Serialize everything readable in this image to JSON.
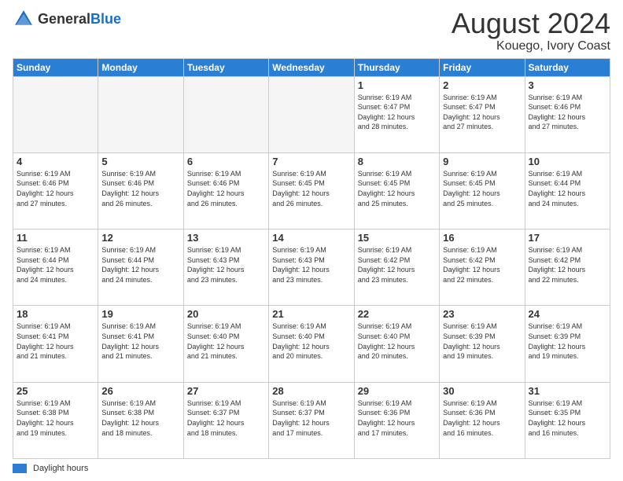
{
  "header": {
    "logo_general": "General",
    "logo_blue": "Blue",
    "month_year": "August 2024",
    "location": "Kouego, Ivory Coast"
  },
  "weekdays": [
    "Sunday",
    "Monday",
    "Tuesday",
    "Wednesday",
    "Thursday",
    "Friday",
    "Saturday"
  ],
  "weeks": [
    [
      {
        "day": "",
        "info": ""
      },
      {
        "day": "",
        "info": ""
      },
      {
        "day": "",
        "info": ""
      },
      {
        "day": "",
        "info": ""
      },
      {
        "day": "1",
        "info": "Sunrise: 6:19 AM\nSunset: 6:47 PM\nDaylight: 12 hours\nand 28 minutes."
      },
      {
        "day": "2",
        "info": "Sunrise: 6:19 AM\nSunset: 6:47 PM\nDaylight: 12 hours\nand 27 minutes."
      },
      {
        "day": "3",
        "info": "Sunrise: 6:19 AM\nSunset: 6:46 PM\nDaylight: 12 hours\nand 27 minutes."
      }
    ],
    [
      {
        "day": "4",
        "info": "Sunrise: 6:19 AM\nSunset: 6:46 PM\nDaylight: 12 hours\nand 27 minutes."
      },
      {
        "day": "5",
        "info": "Sunrise: 6:19 AM\nSunset: 6:46 PM\nDaylight: 12 hours\nand 26 minutes."
      },
      {
        "day": "6",
        "info": "Sunrise: 6:19 AM\nSunset: 6:46 PM\nDaylight: 12 hours\nand 26 minutes."
      },
      {
        "day": "7",
        "info": "Sunrise: 6:19 AM\nSunset: 6:45 PM\nDaylight: 12 hours\nand 26 minutes."
      },
      {
        "day": "8",
        "info": "Sunrise: 6:19 AM\nSunset: 6:45 PM\nDaylight: 12 hours\nand 25 minutes."
      },
      {
        "day": "9",
        "info": "Sunrise: 6:19 AM\nSunset: 6:45 PM\nDaylight: 12 hours\nand 25 minutes."
      },
      {
        "day": "10",
        "info": "Sunrise: 6:19 AM\nSunset: 6:44 PM\nDaylight: 12 hours\nand 24 minutes."
      }
    ],
    [
      {
        "day": "11",
        "info": "Sunrise: 6:19 AM\nSunset: 6:44 PM\nDaylight: 12 hours\nand 24 minutes."
      },
      {
        "day": "12",
        "info": "Sunrise: 6:19 AM\nSunset: 6:44 PM\nDaylight: 12 hours\nand 24 minutes."
      },
      {
        "day": "13",
        "info": "Sunrise: 6:19 AM\nSunset: 6:43 PM\nDaylight: 12 hours\nand 23 minutes."
      },
      {
        "day": "14",
        "info": "Sunrise: 6:19 AM\nSunset: 6:43 PM\nDaylight: 12 hours\nand 23 minutes."
      },
      {
        "day": "15",
        "info": "Sunrise: 6:19 AM\nSunset: 6:42 PM\nDaylight: 12 hours\nand 23 minutes."
      },
      {
        "day": "16",
        "info": "Sunrise: 6:19 AM\nSunset: 6:42 PM\nDaylight: 12 hours\nand 22 minutes."
      },
      {
        "day": "17",
        "info": "Sunrise: 6:19 AM\nSunset: 6:42 PM\nDaylight: 12 hours\nand 22 minutes."
      }
    ],
    [
      {
        "day": "18",
        "info": "Sunrise: 6:19 AM\nSunset: 6:41 PM\nDaylight: 12 hours\nand 21 minutes."
      },
      {
        "day": "19",
        "info": "Sunrise: 6:19 AM\nSunset: 6:41 PM\nDaylight: 12 hours\nand 21 minutes."
      },
      {
        "day": "20",
        "info": "Sunrise: 6:19 AM\nSunset: 6:40 PM\nDaylight: 12 hours\nand 21 minutes."
      },
      {
        "day": "21",
        "info": "Sunrise: 6:19 AM\nSunset: 6:40 PM\nDaylight: 12 hours\nand 20 minutes."
      },
      {
        "day": "22",
        "info": "Sunrise: 6:19 AM\nSunset: 6:40 PM\nDaylight: 12 hours\nand 20 minutes."
      },
      {
        "day": "23",
        "info": "Sunrise: 6:19 AM\nSunset: 6:39 PM\nDaylight: 12 hours\nand 19 minutes."
      },
      {
        "day": "24",
        "info": "Sunrise: 6:19 AM\nSunset: 6:39 PM\nDaylight: 12 hours\nand 19 minutes."
      }
    ],
    [
      {
        "day": "25",
        "info": "Sunrise: 6:19 AM\nSunset: 6:38 PM\nDaylight: 12 hours\nand 19 minutes."
      },
      {
        "day": "26",
        "info": "Sunrise: 6:19 AM\nSunset: 6:38 PM\nDaylight: 12 hours\nand 18 minutes."
      },
      {
        "day": "27",
        "info": "Sunrise: 6:19 AM\nSunset: 6:37 PM\nDaylight: 12 hours\nand 18 minutes."
      },
      {
        "day": "28",
        "info": "Sunrise: 6:19 AM\nSunset: 6:37 PM\nDaylight: 12 hours\nand 17 minutes."
      },
      {
        "day": "29",
        "info": "Sunrise: 6:19 AM\nSunset: 6:36 PM\nDaylight: 12 hours\nand 17 minutes."
      },
      {
        "day": "30",
        "info": "Sunrise: 6:19 AM\nSunset: 6:36 PM\nDaylight: 12 hours\nand 16 minutes."
      },
      {
        "day": "31",
        "info": "Sunrise: 6:19 AM\nSunset: 6:35 PM\nDaylight: 12 hours\nand 16 minutes."
      }
    ]
  ],
  "footer": {
    "legend_label": "Daylight hours"
  }
}
